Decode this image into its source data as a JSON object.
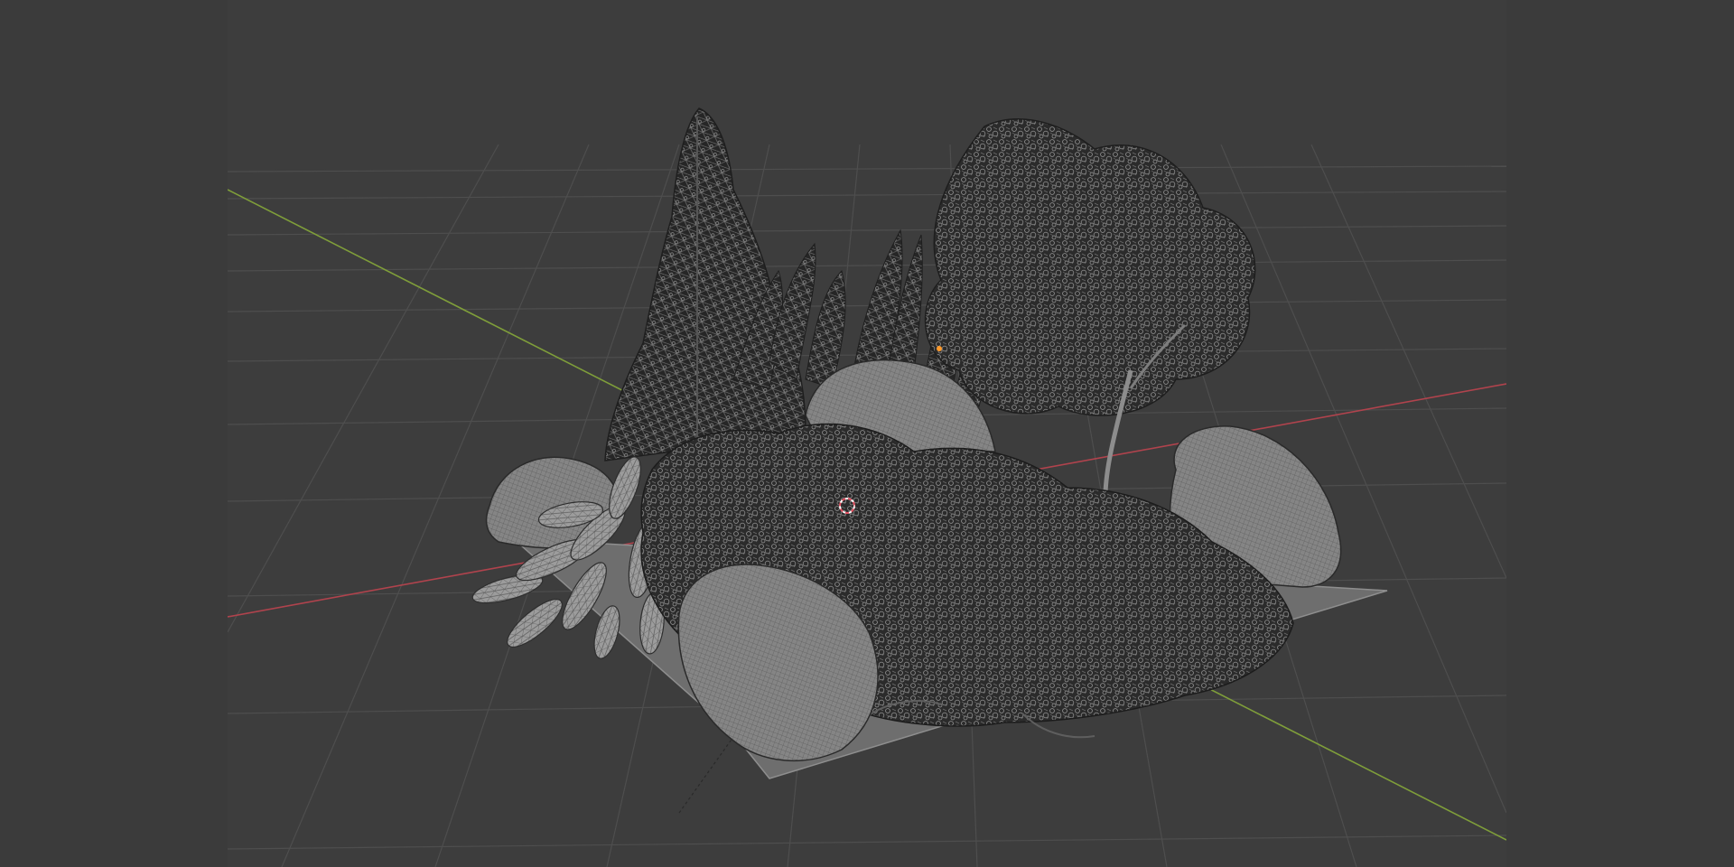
{
  "app": {
    "kind": "3d-viewport",
    "view": "perspective",
    "shading": "wireframe"
  },
  "colors": {
    "viewport_bg": "#3d3d3d",
    "side_bars": "#3b3b3b",
    "grid_line": "#4f4f4f",
    "x_axis": "#b0434d",
    "y_axis": "#7f9e3a",
    "wire_dark": "#2a2a2a",
    "wire_light": "#8a8a8a",
    "ground_plane": "#6f6f6f",
    "cursor_red": "#e05060",
    "cursor_white": "#ffffff",
    "origin_orange": "#ff9a2a"
  },
  "scene": {
    "objects": [
      {
        "name": "conifer",
        "type": "tree"
      },
      {
        "name": "fern-cluster",
        "type": "plant"
      },
      {
        "name": "broadleaf-tree",
        "type": "tree"
      },
      {
        "name": "boulder-front",
        "type": "rock"
      },
      {
        "name": "boulder-center",
        "type": "rock"
      },
      {
        "name": "boulder-right",
        "type": "rock"
      },
      {
        "name": "boulder-left",
        "type": "rock"
      },
      {
        "name": "hosta-plant",
        "type": "plant"
      },
      {
        "name": "flowering-shrub",
        "type": "shrub"
      },
      {
        "name": "ground-plane",
        "type": "plane"
      }
    ]
  }
}
